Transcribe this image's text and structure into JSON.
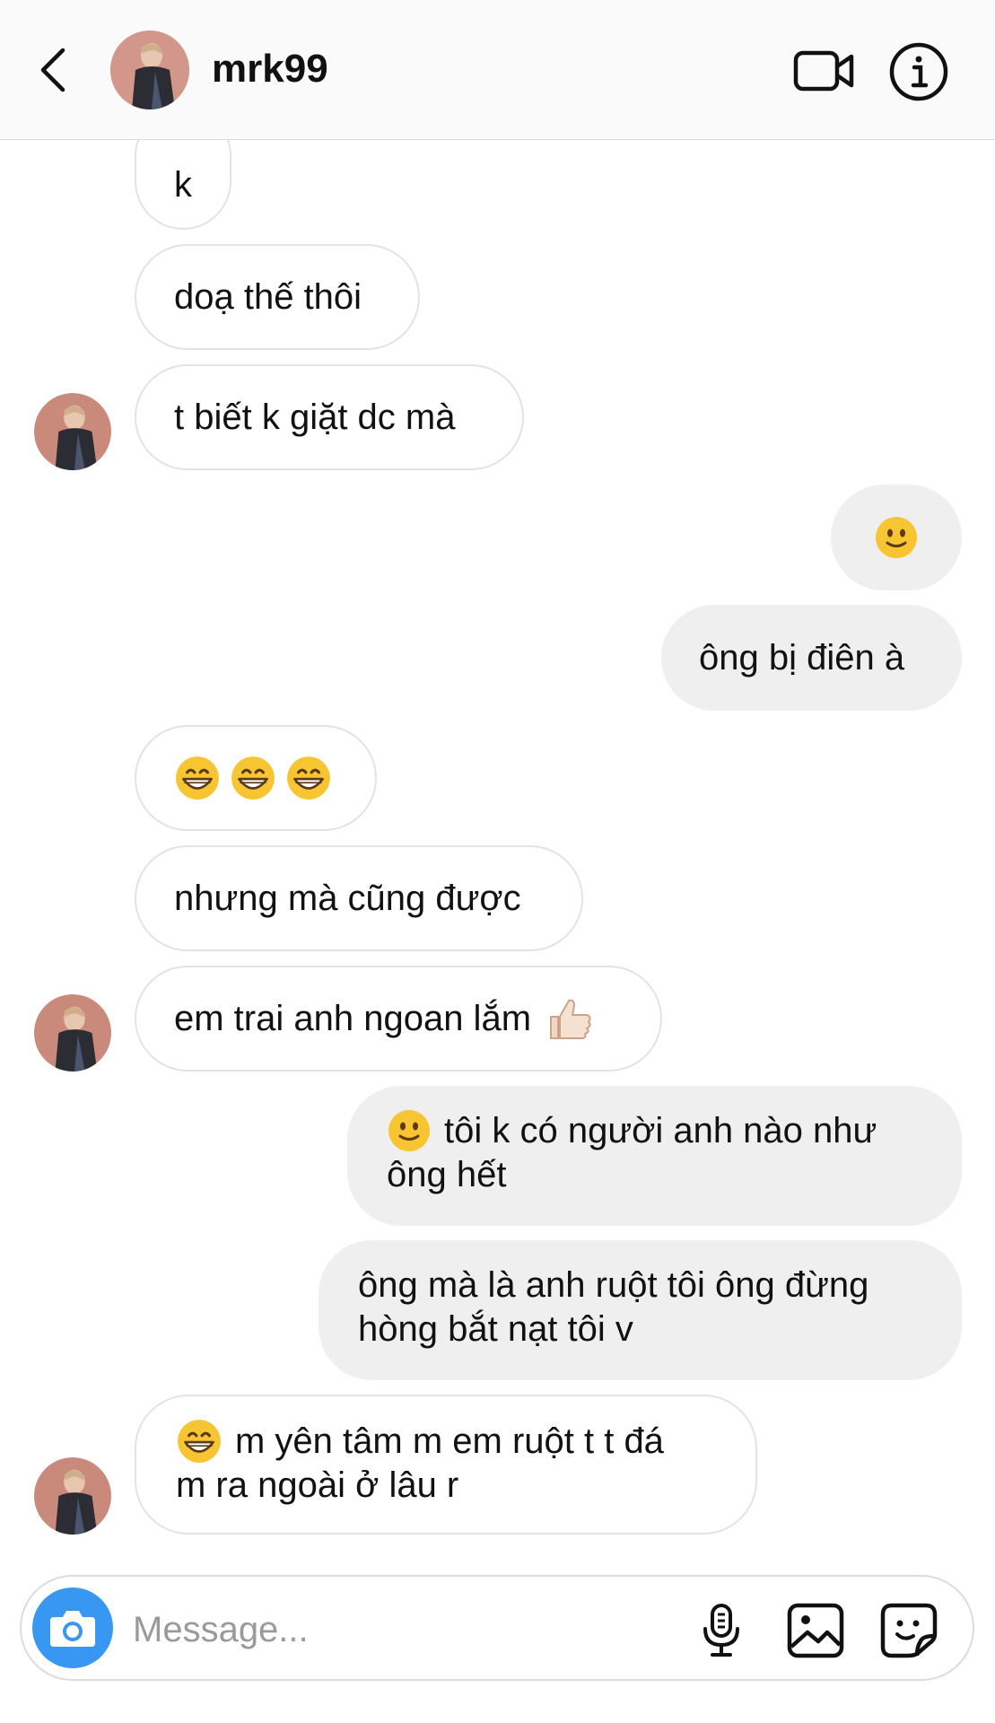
{
  "header": {
    "username": "mrk99",
    "icons": {
      "back": "chevron-left-icon",
      "video": "video-camera-icon",
      "info": "info-icon"
    }
  },
  "messages": [
    {
      "side": "incoming",
      "text": "k"
    },
    {
      "side": "incoming",
      "text": "doạ thế thôi"
    },
    {
      "side": "incoming",
      "text": "t biết k giặt dc mà"
    },
    {
      "side": "outgoing",
      "emoji": "slightly-smiling-face"
    },
    {
      "side": "outgoing",
      "text": "ông bị điên à"
    },
    {
      "side": "incoming",
      "emoji": "grinning-face x3"
    },
    {
      "side": "incoming",
      "text": "nhưng mà cũng được"
    },
    {
      "side": "incoming",
      "text": "em trai anh ngoan lắm",
      "emoji_after": "thumbs-up"
    },
    {
      "side": "outgoing",
      "emoji_before": "slightly-smiling-face",
      "line1": "tôi k có người anh nào như",
      "line2": "ông hết"
    },
    {
      "side": "outgoing",
      "line1": "ông mà là anh ruột tôi ông đừng",
      "line2": "hòng bắt nạt tôi v"
    },
    {
      "side": "incoming",
      "emoji_before": "grinning-face",
      "line1": "m yên tâm m em ruột t t đá",
      "line2": "m ra ngoài ở lâu r"
    }
  ],
  "composer": {
    "placeholder": "Message...",
    "icons": {
      "camera": "camera-icon",
      "mic": "microphone-icon",
      "gallery": "image-icon",
      "sticker": "sticker-icon"
    }
  },
  "colors": {
    "camera_button": "#3897f0",
    "incoming_border": "#e3e3e3",
    "outgoing_bg": "#efefef",
    "header_bg": "#fafafa"
  }
}
